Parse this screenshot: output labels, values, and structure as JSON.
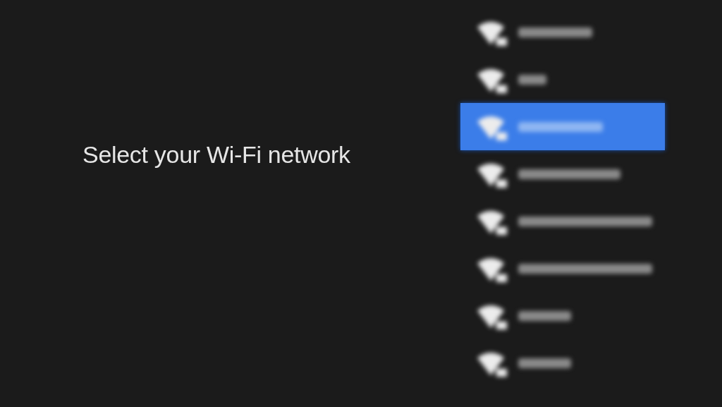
{
  "heading": "Select your Wi-Fi network",
  "networks": [
    {
      "kind": "blurred",
      "selected": false
    },
    {
      "kind": "blurred",
      "selected": false
    },
    {
      "kind": "blurred",
      "selected": true
    },
    {
      "kind": "blurred",
      "selected": false
    },
    {
      "kind": "blurred",
      "selected": false
    },
    {
      "kind": "blurred",
      "selected": false
    },
    {
      "kind": "blurred",
      "selected": false
    },
    {
      "kind": "blurred",
      "selected": false
    }
  ]
}
